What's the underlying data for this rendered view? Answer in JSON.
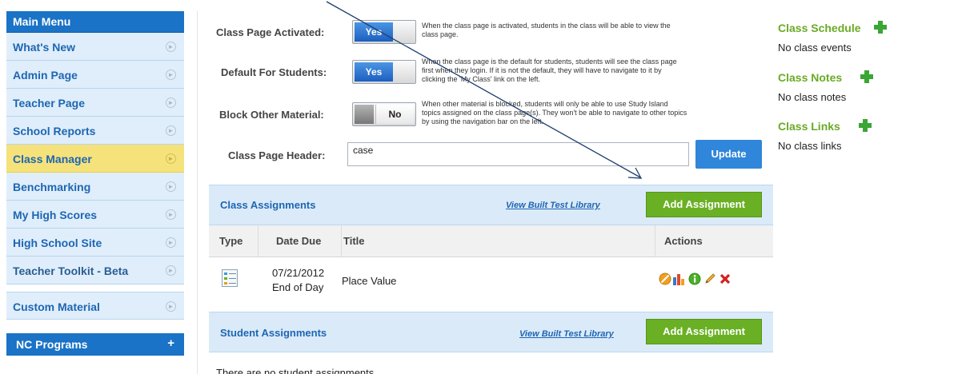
{
  "sidebar": {
    "header": "Main Menu",
    "items": [
      {
        "label": "What's New"
      },
      {
        "label": "Admin Page"
      },
      {
        "label": "Teacher Page"
      },
      {
        "label": "School Reports"
      },
      {
        "label": "Class Manager",
        "active": true
      },
      {
        "label": "Benchmarking"
      },
      {
        "label": "My High Scores"
      },
      {
        "label": "High School Site"
      },
      {
        "label": "Teacher Toolkit - Beta"
      }
    ],
    "custom_material": "Custom Material",
    "nc_programs": "NC Programs",
    "nc_programs_icon": "+"
  },
  "settings": {
    "page_activated": {
      "label": "Class Page Activated:",
      "state": "Yes",
      "desc_line1": "When the class page is activated, students in the class will be able to view the",
      "desc_line2": "class page."
    },
    "default_for_students": {
      "label": "Default For Students:",
      "state": "Yes",
      "desc_line1": "When the class page is the default for students, students will see the class page",
      "desc_line2": "first when they login. If it is not the default, they will have to navigate to it by",
      "desc_line3": "clicking the 'My Class' link on the left."
    },
    "block_other_material": {
      "label": "Block Other Material:",
      "state": "No",
      "desc_line1": "When other material is blocked, students will only be able to use Study Island",
      "desc_line2": "topics assigned on the class page(s). They won't be able to navigate to other topics",
      "desc_line3": "by using the navigation bar on the left."
    },
    "header": {
      "label": "Class Page Header:",
      "value": "case",
      "update_button": "Update"
    }
  },
  "class_assignments": {
    "title": "Class Assignments",
    "library_link": "View Built Test Library",
    "add_button": "Add Assignment",
    "columns": [
      "Type",
      "Date Due",
      "Title",
      "Actions"
    ],
    "rows": [
      {
        "date": "07/21/2012",
        "due_time": "End of Day",
        "title": "Place Value"
      }
    ]
  },
  "student_assignments": {
    "title": "Student Assignments",
    "library_link": "View Built Test Library",
    "add_button": "Add Assignment",
    "empty_message": "There are no student assignments."
  },
  "right_column": {
    "schedule_title": "Class Schedule",
    "schedule_text": "No class events",
    "notes_title": "Class Notes",
    "notes_text": "No class notes",
    "links_title": "Class Links",
    "links_text": "No class links"
  },
  "colors": {
    "brand_blue": "#1a73c6",
    "active_menu": "#f5e27a",
    "green_button": "#6ab024",
    "side_title_green": "#6aaa25"
  },
  "icons": [
    "chevron-right-icon",
    "plus-icon",
    "assignment-list-icon",
    "disable-icon",
    "chart-icon",
    "info-icon",
    "edit-pencil-icon",
    "delete-x-icon",
    "green-plus-icon"
  ]
}
